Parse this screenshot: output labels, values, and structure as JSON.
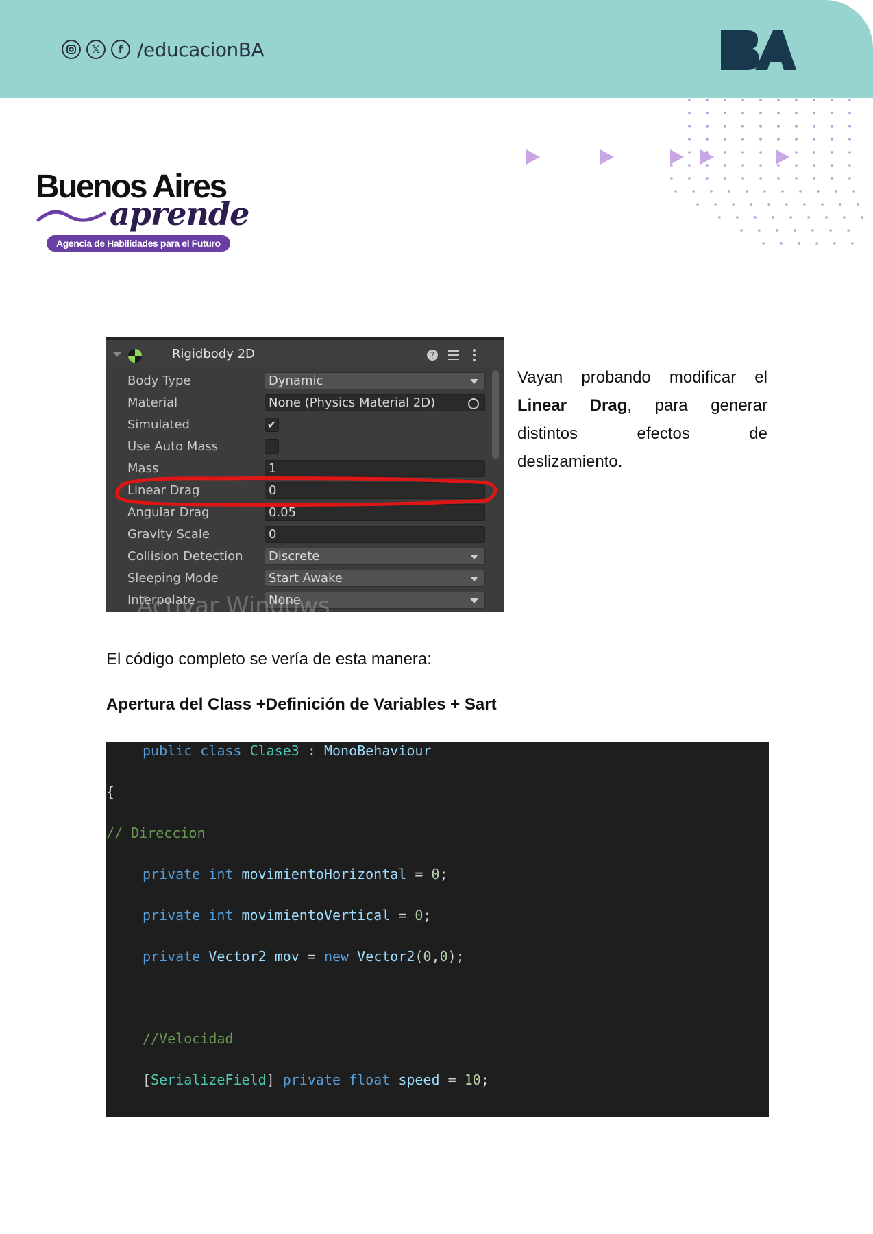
{
  "header": {
    "handle": "/educacionBA",
    "social_icons": [
      "instagram-icon",
      "x-icon",
      "facebook-icon"
    ],
    "logo_text": "BA",
    "band_color": "#97d4cf"
  },
  "brand": {
    "title": "Buenos Aires",
    "script": "aprende",
    "tagline": "Agencia de Habilidades para el Futuro",
    "accent": "#6a3fa4"
  },
  "inspector": {
    "title": "Rigidbody 2D",
    "rows": [
      {
        "label": "Body Type",
        "value": "Dynamic",
        "kind": "dropdown"
      },
      {
        "label": "Material",
        "value": "None (Physics Material 2D)",
        "kind": "object"
      },
      {
        "label": "Simulated",
        "value": "✔",
        "kind": "checkbox"
      },
      {
        "label": "Use Auto Mass",
        "value": "",
        "kind": "checkbox"
      },
      {
        "label": "Mass",
        "value": "1",
        "kind": "field"
      },
      {
        "label": "Linear Drag",
        "value": "0",
        "kind": "field"
      },
      {
        "label": "Angular Drag",
        "value": "0.05",
        "kind": "field"
      },
      {
        "label": "Gravity Scale",
        "value": "0",
        "kind": "field"
      },
      {
        "label": "Collision Detection",
        "value": "Discrete",
        "kind": "dropdown"
      },
      {
        "label": "Sleeping Mode",
        "value": "Start Awake",
        "kind": "dropdown"
      },
      {
        "label": "Interpolate",
        "value": "None",
        "kind": "dropdown"
      }
    ],
    "watermark": "Activar Windows"
  },
  "side_text": {
    "before": "Vayan probando modificar el",
    "bold": "Linear Drag",
    "after": ", para generar distintos efectos de deslizamiento."
  },
  "paragraph": "El código completo se vería de esta manera:",
  "subheading": "Apertura del Class +Definición de Variables + Sart",
  "code": {
    "line1": [
      "public",
      "class",
      "Clase3",
      ":",
      "MonoBehaviour"
    ],
    "brace": "{",
    "comment1": "// Direccion",
    "line3": [
      "private",
      "int",
      "movimientoHorizontal",
      "=",
      "0",
      ";"
    ],
    "line4": [
      "private",
      "int",
      "movimientoVertical",
      "=",
      "0",
      ";"
    ],
    "line5": [
      "private",
      "Vector2",
      "mov",
      "=",
      "new",
      "Vector2",
      "(",
      "0",
      ",",
      "0",
      ");"
    ],
    "comment2": "//Velocidad",
    "line6": [
      "[",
      "SerializeField",
      "]",
      "private",
      "float",
      "speed",
      "=",
      "10",
      ";"
    ]
  }
}
